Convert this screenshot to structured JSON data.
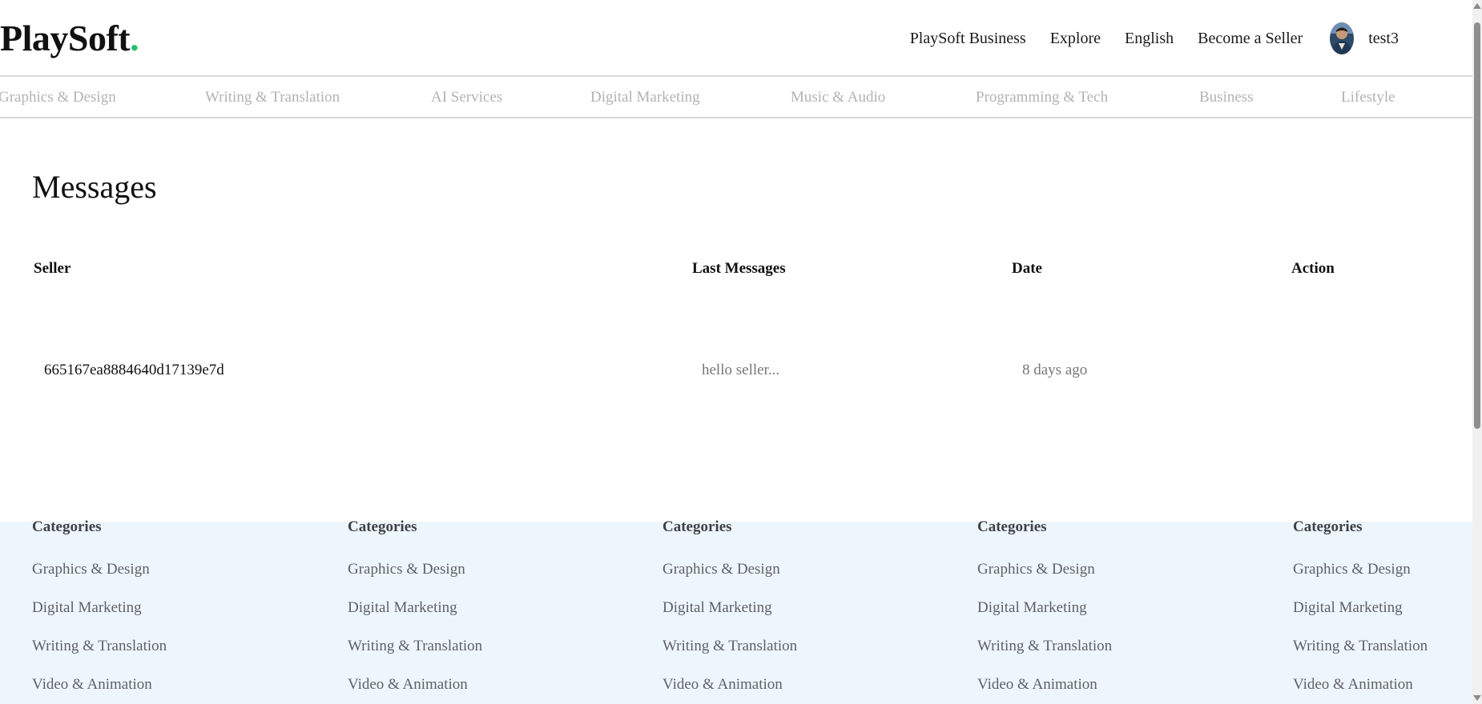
{
  "brand": {
    "name": "PlaySoft",
    "dot": ".",
    "dot_color": "#1dbf73"
  },
  "nav": {
    "links": [
      "PlaySoft Business",
      "Explore",
      "English",
      "Become a Seller"
    ],
    "username": "test3",
    "avatar_icon": "user-avatar"
  },
  "categories_bar": [
    "Graphics & Design",
    "Writing & Translation",
    "AI Services",
    "Digital Marketing",
    "Music & Audio",
    "Programming & Tech",
    "Business",
    "Lifestyle"
  ],
  "page": {
    "title": "Messages"
  },
  "table": {
    "headers": {
      "seller": "Seller",
      "last_messages": "Last Messages",
      "date": "Date",
      "action": "Action"
    },
    "rows": [
      {
        "seller": "665167ea8884640d17139e7d",
        "last_message": "hello seller...",
        "date": "8 days ago"
      }
    ]
  },
  "footer": {
    "columns": [
      {
        "heading": "Categories",
        "links": [
          "Graphics & Design",
          "Digital Marketing",
          "Writing & Translation",
          "Video & Animation"
        ]
      },
      {
        "heading": "Categories",
        "links": [
          "Graphics & Design",
          "Digital Marketing",
          "Writing & Translation",
          "Video & Animation"
        ]
      },
      {
        "heading": "Categories",
        "links": [
          "Graphics & Design",
          "Digital Marketing",
          "Writing & Translation",
          "Video & Animation"
        ]
      },
      {
        "heading": "Categories",
        "links": [
          "Graphics & Design",
          "Digital Marketing",
          "Writing & Translation",
          "Video & Animation"
        ]
      },
      {
        "heading": "Categories",
        "links": [
          "Graphics & Design",
          "Digital Marketing",
          "Writing & Translation",
          "Video & Animation"
        ]
      }
    ],
    "background_color": "#eef6fd"
  }
}
